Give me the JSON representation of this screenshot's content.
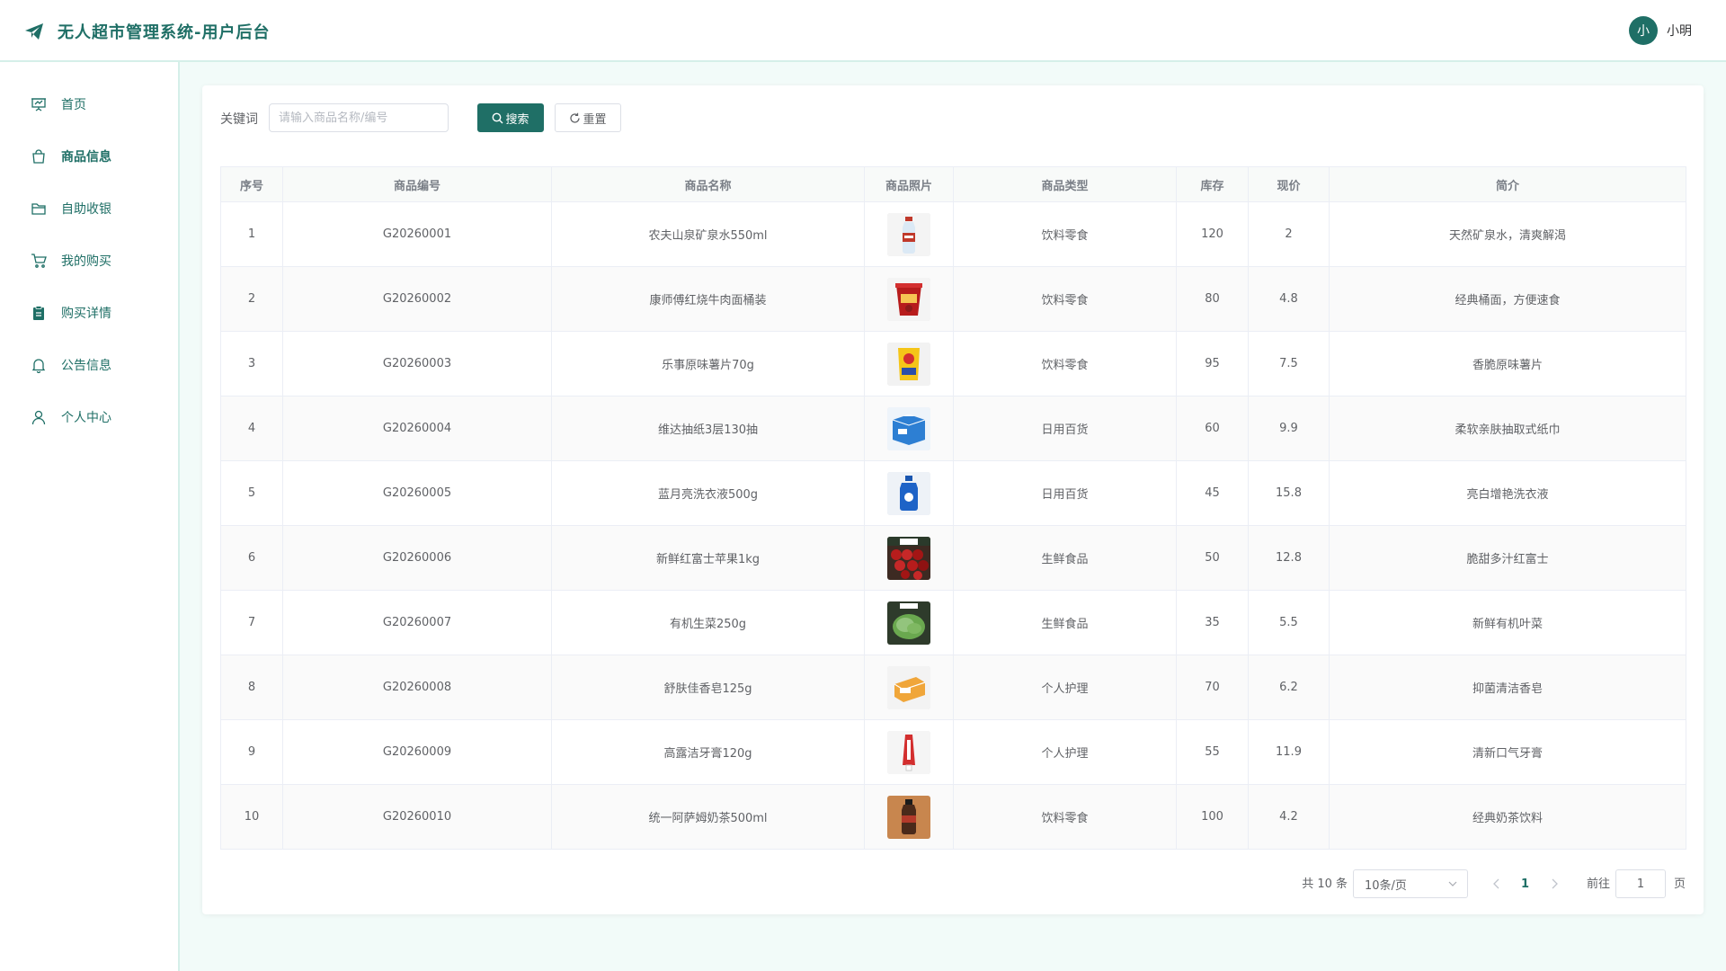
{
  "header": {
    "title": "无人超市管理系统-用户后台",
    "avatar_text": "小",
    "username": "小明"
  },
  "sidebar": {
    "items": [
      {
        "label": "首页",
        "icon": "presentation-icon"
      },
      {
        "label": "商品信息",
        "icon": "shopping-bag-icon",
        "active": true
      },
      {
        "label": "自助收银",
        "icon": "folder-icon"
      },
      {
        "label": "我的购买",
        "icon": "cart-icon"
      },
      {
        "label": "购买详情",
        "icon": "clipboard-icon"
      },
      {
        "label": "公告信息",
        "icon": "bell-icon"
      },
      {
        "label": "个人中心",
        "icon": "user-icon"
      }
    ]
  },
  "search": {
    "label": "关键词",
    "placeholder": "请输入商品名称/编号",
    "value": "",
    "search_button": "搜索",
    "reset_button": "重置"
  },
  "table": {
    "columns": [
      "序号",
      "商品编号",
      "商品名称",
      "商品照片",
      "商品类型",
      "库存",
      "现价",
      "简介"
    ],
    "rows": [
      {
        "no": "1",
        "code": "G20260001",
        "name": "农夫山泉矿泉水550ml",
        "type": "饮料零食",
        "stock": "120",
        "price": "2",
        "desc": "天然矿泉水，清爽解渴",
        "photo": "water-bottle"
      },
      {
        "no": "2",
        "code": "G20260002",
        "name": "康师傅红烧牛肉面桶装",
        "type": "饮料零食",
        "stock": "80",
        "price": "4.8",
        "desc": "经典桶面，方便速食",
        "photo": "noodle-cup"
      },
      {
        "no": "3",
        "code": "G20260003",
        "name": "乐事原味薯片70g",
        "type": "饮料零食",
        "stock": "95",
        "price": "7.5",
        "desc": "香脆原味薯片",
        "photo": "chips-bag"
      },
      {
        "no": "4",
        "code": "G20260004",
        "name": "维达抽纸3层130抽",
        "type": "日用百货",
        "stock": "60",
        "price": "9.9",
        "desc": "柔软亲肤抽取式纸巾",
        "photo": "tissue-box"
      },
      {
        "no": "5",
        "code": "G20260005",
        "name": "蓝月亮洗衣液500g",
        "type": "日用百货",
        "stock": "45",
        "price": "15.8",
        "desc": "亮白增艳洗衣液",
        "photo": "detergent-bottle"
      },
      {
        "no": "6",
        "code": "G20260006",
        "name": "新鲜红富士苹果1kg",
        "type": "生鲜食品",
        "stock": "50",
        "price": "12.8",
        "desc": "脆甜多汁红富士",
        "photo": "apples"
      },
      {
        "no": "7",
        "code": "G20260007",
        "name": "有机生菜250g",
        "type": "生鲜食品",
        "stock": "35",
        "price": "5.5",
        "desc": "新鲜有机叶菜",
        "photo": "lettuce"
      },
      {
        "no": "8",
        "code": "G20260008",
        "name": "舒肤佳香皂125g",
        "type": "个人护理",
        "stock": "70",
        "price": "6.2",
        "desc": "抑菌清洁香皂",
        "photo": "soap"
      },
      {
        "no": "9",
        "code": "G20260009",
        "name": "高露洁牙膏120g",
        "type": "个人护理",
        "stock": "55",
        "price": "11.9",
        "desc": "清新口气牙膏",
        "photo": "toothpaste"
      },
      {
        "no": "10",
        "code": "G20260010",
        "name": "统一阿萨姆奶茶500ml",
        "type": "饮料零食",
        "stock": "100",
        "price": "4.2",
        "desc": "经典奶茶饮料",
        "photo": "milk-tea"
      }
    ]
  },
  "pagination": {
    "total": "共 10 条",
    "page_size": "10条/页",
    "current": "1",
    "goto_label": "前往",
    "goto_value": "1",
    "page_unit": "页"
  },
  "colors": {
    "primary": "#1f6f66",
    "background": "#f2fbf9"
  }
}
